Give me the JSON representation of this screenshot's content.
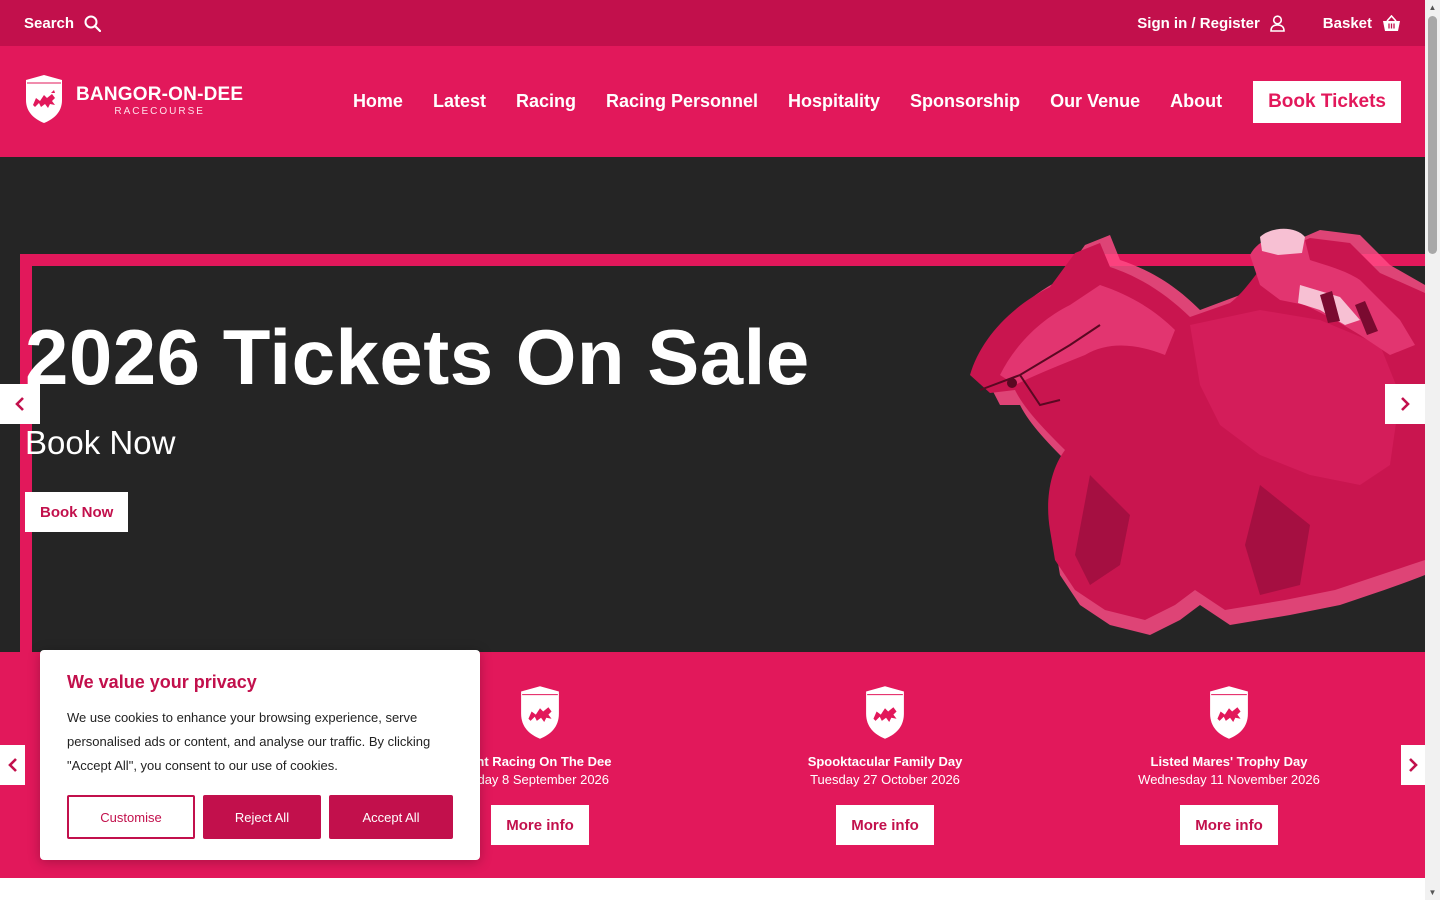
{
  "topbar": {
    "search_label": "Search",
    "signin_label": "Sign in / Register",
    "basket_label": "Basket"
  },
  "logo": {
    "name": "BANGOR-ON-DEE",
    "sub": "RACECOURSE"
  },
  "nav": {
    "items": [
      "Home",
      "Latest",
      "Racing",
      "Racing Personnel",
      "Hospitality",
      "Sponsorship",
      "Our Venue",
      "About"
    ],
    "cta": "Book Tickets"
  },
  "hero": {
    "title": "2026 Tickets On Sale",
    "subtitle": "Book Now",
    "button": "Book Now"
  },
  "events": [
    {
      "name": "ght Racing On The Dee",
      "date": "sday 8 September 2026",
      "button": "More info"
    },
    {
      "name": "Spooktacular Family Day",
      "date": "Tuesday 27 October 2026",
      "button": "More info"
    },
    {
      "name": "Listed Mares' Trophy Day",
      "date": "Wednesday 11 November 2026",
      "button": "More info"
    }
  ],
  "cookie": {
    "title": "We value your privacy",
    "text": "We use cookies to enhance your browsing experience, serve personalised ads or content, and analyse our traffic. By clicking \"Accept All\", you consent to our use of cookies.",
    "customise": "Customise",
    "reject": "Reject All",
    "accept": "Accept All"
  },
  "colors": {
    "brand": "#e2185b",
    "brand_dark": "#c2104c",
    "hero_bg": "#252525"
  },
  "icons": {
    "search": "search-icon",
    "user": "user-icon",
    "basket": "basket-icon",
    "shield": "dragon-shield-icon",
    "prev": "chevron-left-icon",
    "next": "chevron-right-icon"
  }
}
